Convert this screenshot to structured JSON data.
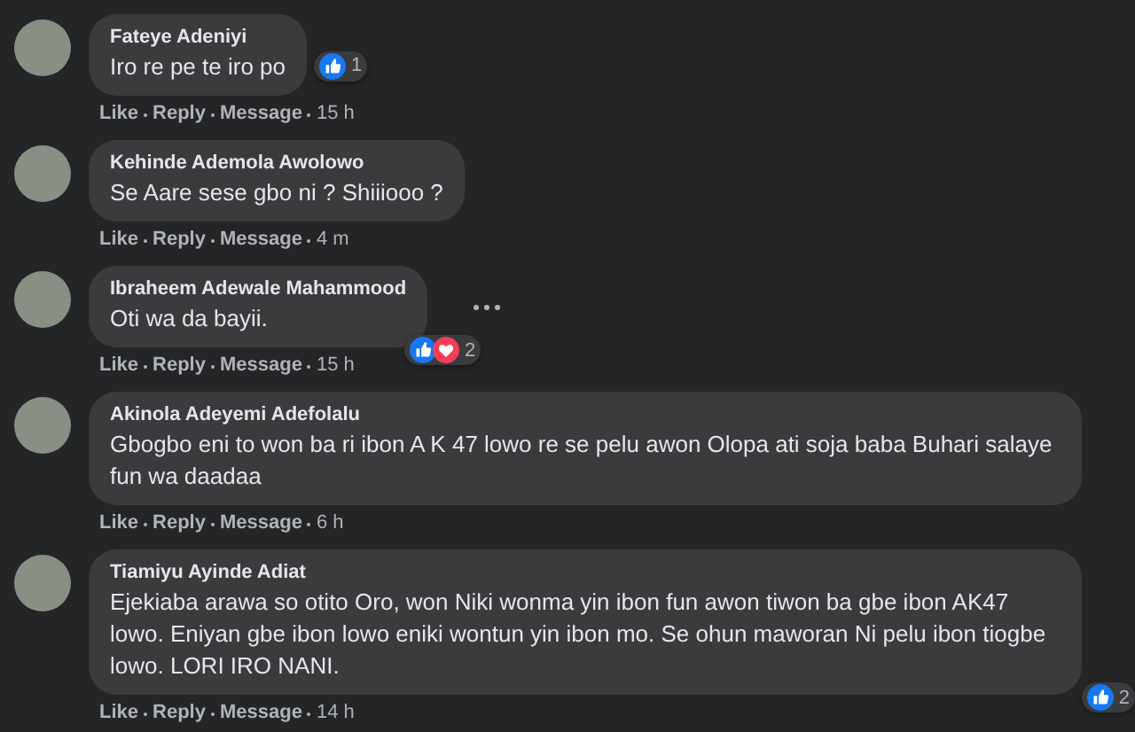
{
  "comments": [
    {
      "author": "Fateye Adeniyi",
      "text": "Iro re pe te iro po",
      "reactions": {
        "kind": "inline",
        "icons": [
          {
            "kind": "like"
          }
        ],
        "count": "1"
      },
      "actions": [
        "Like",
        "Reply",
        "Message"
      ],
      "time": "15 h",
      "menu": false
    },
    {
      "author": "Kehinde Ademola Awolowo",
      "text": "Se Aare sese gbo ni ? Shiiiooo ?",
      "actions": [
        "Like",
        "Reply",
        "Message"
      ],
      "time": "4 m",
      "menu": false
    },
    {
      "author": "Ibraheem Adewale Mahammood",
      "text": "Oti wa da bayii.",
      "reactions": {
        "kind": "corner",
        "icons": [
          {
            "kind": "like"
          },
          {
            "kind": "love"
          }
        ],
        "count": "2"
      },
      "actions": [
        "Like",
        "Reply",
        "Message"
      ],
      "time": "15 h",
      "menu": true
    },
    {
      "author": "Akinola Adeyemi Adefolalu",
      "text": "Gbogbo eni to won ba ri ibon A K 47 lowo re se pelu awon Olopa ati soja baba Buhari salaye fun wa daadaa",
      "actions": [
        "Like",
        "Reply",
        "Message"
      ],
      "time": "6 h",
      "menu": false
    },
    {
      "author": "Tiamiyu Ayinde Adiat",
      "text": "Ejekiaba arawa so otito Oro, won Niki wonma yin ibon fun awon tiwon ba gbe ibon AK47 lowo. Eniyan gbe ibon lowo eniki wontun yin ibon mo. Se ohun maworan Ni pelu ibon tiogbe lowo. LORI IRO NANI.",
      "reactions": {
        "kind": "corner",
        "icons": [
          {
            "kind": "like"
          }
        ],
        "count": "2"
      },
      "actions": [
        "Like",
        "Reply",
        "Message"
      ],
      "time": "14 h",
      "menu": false
    }
  ]
}
